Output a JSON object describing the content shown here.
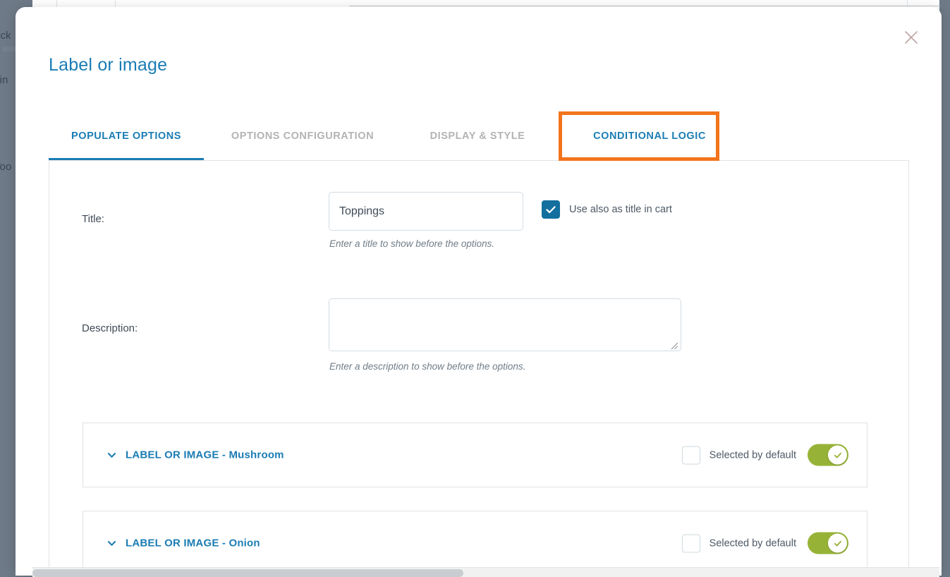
{
  "background": {
    "fragments": [
      "ock",
      "ttin",
      "Too"
    ]
  },
  "modal": {
    "title": "Label or image",
    "close_icon": "close-icon",
    "tabs": [
      {
        "label": "POPULATE OPTIONS",
        "active": true,
        "highlighted": false
      },
      {
        "label": "OPTIONS CONFIGURATION",
        "active": false,
        "highlighted": false
      },
      {
        "label": "DISPLAY & STYLE",
        "active": false,
        "highlighted": false
      },
      {
        "label": "CONDITIONAL LOGIC",
        "active": false,
        "highlighted": true
      }
    ],
    "highlight_color": "#f2741b",
    "accent_color": "#1b7cb4"
  },
  "form": {
    "title_field": {
      "label": "Title:",
      "value": "Toppings",
      "placeholder": "",
      "help": "Enter a title to show before the options.",
      "checkbox_label": "Use also as title in cart",
      "checkbox_checked": true
    },
    "description_field": {
      "label": "Description:",
      "value": "",
      "placeholder": "",
      "help": "Enter a description to show before the options."
    }
  },
  "options": [
    {
      "title": "LABEL OR IMAGE - Mushroom",
      "chevron_icon": "chevron-down-icon",
      "selected_by_default_label": "Selected by default",
      "selected_by_default_checked": false,
      "toggle_on": true
    },
    {
      "title": "LABEL OR IMAGE - Onion",
      "chevron_icon": "chevron-down-icon",
      "selected_by_default_label": "Selected by default",
      "selected_by_default_checked": false,
      "toggle_on": true
    }
  ],
  "colors": {
    "toggle_on": "#97b337",
    "checkbox_checked": "#136f9e",
    "overlay": "#6e7a87"
  }
}
